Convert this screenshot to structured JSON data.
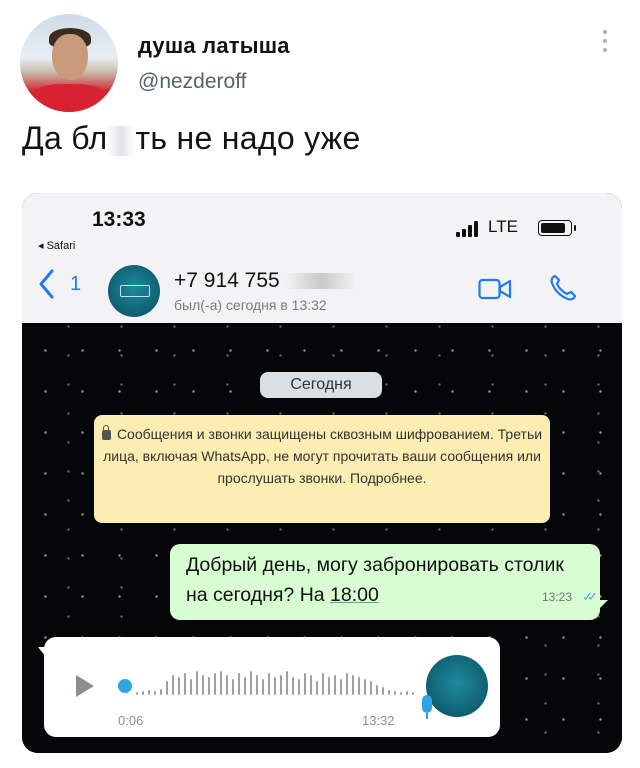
{
  "tweet": {
    "author_name": "душа латыша",
    "author_handle": "@nezderoff",
    "text_part1": "Да бл",
    "text_part2": "ть не надо уже"
  },
  "screenshot": {
    "status_bar": {
      "time": "13:33",
      "back_app": "◂ Safari",
      "network": "LTE"
    },
    "header": {
      "back_count": "1",
      "contact_name": "+7 914 755",
      "contact_status": "был(-а) сегодня в 13:32"
    },
    "chat": {
      "date_label": "Сегодня",
      "encryption_notice": "Сообщения и звонки защищены сквозным шифрованием. Третьи лица, включая WhatsApp, не могут прочитать ваши сообщения или прослушать звонки. Подробнее.",
      "outgoing_message_part1": "Добрый день, могу забронировать столик на сегодня? На ",
      "outgoing_message_highlight": "18:00",
      "outgoing_time": "13:23",
      "voice_duration": "0:06",
      "voice_time": "13:32"
    }
  },
  "colors": {
    "ios_blue": "#1f7aef",
    "whatsapp_outgoing": "#d9fdd3",
    "notice_yellow": "#fcedb3",
    "read_checks": "#4fa3d6"
  }
}
